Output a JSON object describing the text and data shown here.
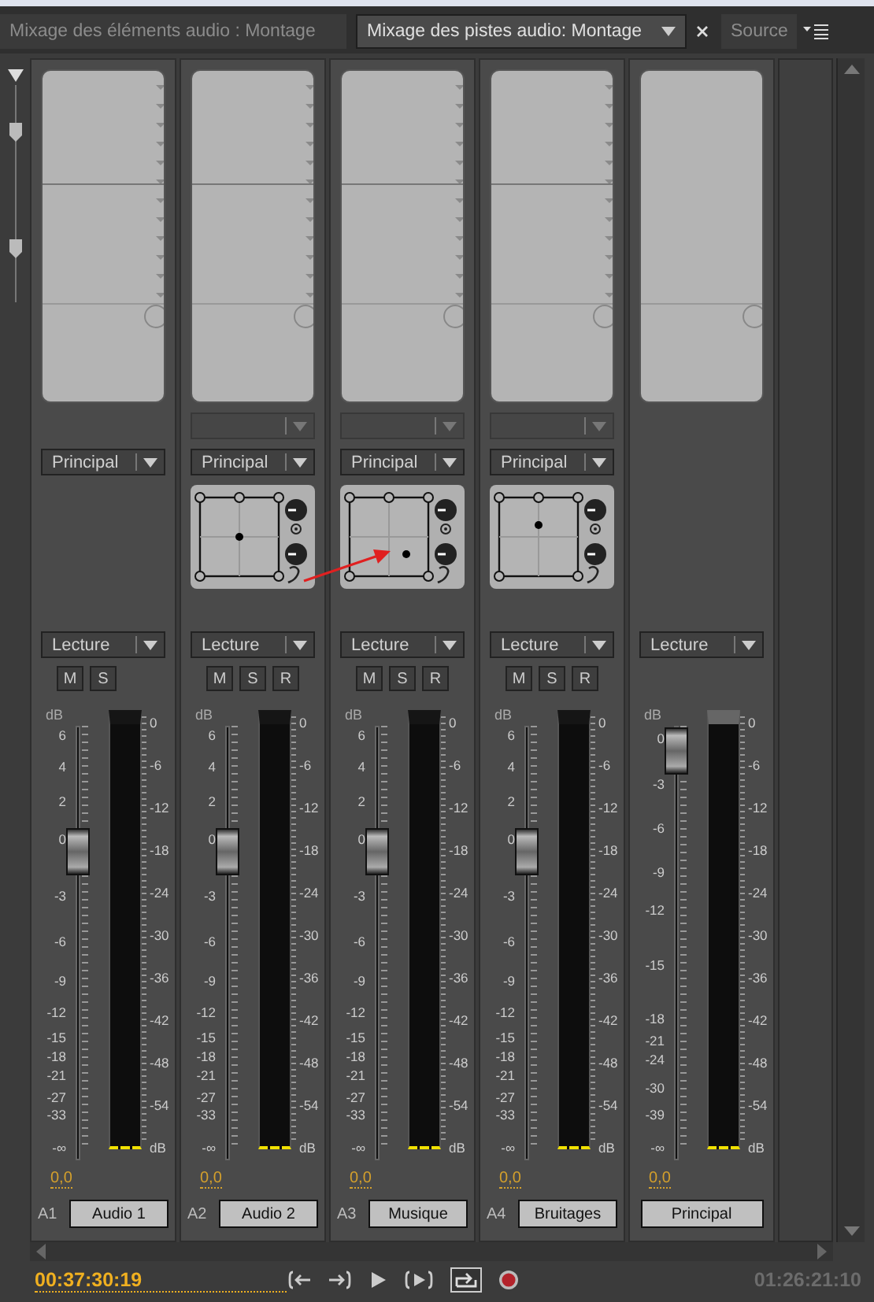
{
  "tabs": [
    {
      "label": "Mixage des éléments audio : Montage",
      "selected": false
    },
    {
      "label": "Mixage des pistes audio: Montage",
      "selected": true
    },
    {
      "label": "Source",
      "selected": false
    }
  ],
  "strips": [
    {
      "kind": "track",
      "send": false,
      "output": "Principal",
      "panner": false,
      "automation": "Lecture",
      "buttons": [
        "M",
        "S"
      ],
      "fader": {
        "labels": [
          "6",
          "4",
          "2",
          "0",
          "-3",
          "-6",
          "-9",
          "-12",
          "-15",
          "-18",
          "-21",
          "-27",
          "-33",
          "-∞"
        ],
        "level": 0.74
      },
      "unit": "dB",
      "meter_labels": [
        "0",
        "-6",
        "-12",
        "-18",
        "-24",
        "-30",
        "-36",
        "-42",
        "-48",
        "-54",
        "dB"
      ],
      "reading": "0,0",
      "id": "A1",
      "name": "Audio 1"
    },
    {
      "kind": "track",
      "send": true,
      "output": "Principal",
      "panner": true,
      "automation": "Lecture",
      "buttons": [
        "M",
        "S",
        "R"
      ],
      "fader": {
        "labels": [
          "6",
          "4",
          "2",
          "0",
          "-3",
          "-6",
          "-9",
          "-12",
          "-15",
          "-18",
          "-21",
          "-27",
          "-33",
          "-∞"
        ],
        "level": 0.74
      },
      "unit": "dB",
      "meter_labels": [
        "0",
        "-6",
        "-12",
        "-18",
        "-24",
        "-30",
        "-36",
        "-42",
        "-48",
        "-54",
        "dB"
      ],
      "reading": "0,0",
      "id": "A2",
      "name": "Audio 2"
    },
    {
      "kind": "track",
      "send": true,
      "output": "Principal",
      "panner": true,
      "automation": "Lecture",
      "buttons": [
        "M",
        "S",
        "R"
      ],
      "fader": {
        "labels": [
          "6",
          "4",
          "2",
          "0",
          "-3",
          "-6",
          "-9",
          "-12",
          "-15",
          "-18",
          "-21",
          "-27",
          "-33",
          "-∞"
        ],
        "level": 0.74
      },
      "unit": "dB",
      "meter_labels": [
        "0",
        "-6",
        "-12",
        "-18",
        "-24",
        "-30",
        "-36",
        "-42",
        "-48",
        "-54",
        "dB"
      ],
      "reading": "0,0",
      "id": "A3",
      "name": "Musique"
    },
    {
      "kind": "track",
      "send": true,
      "output": "Principal",
      "panner": true,
      "automation": "Lecture",
      "buttons": [
        "M",
        "S",
        "R"
      ],
      "fader": {
        "labels": [
          "6",
          "4",
          "2",
          "0",
          "-3",
          "-6",
          "-9",
          "-12",
          "-15",
          "-18",
          "-21",
          "-27",
          "-33",
          "-∞"
        ],
        "level": 0.74
      },
      "unit": "dB",
      "meter_labels": [
        "0",
        "-6",
        "-12",
        "-18",
        "-24",
        "-30",
        "-36",
        "-42",
        "-48",
        "-54",
        "dB"
      ],
      "reading": "0,0",
      "id": "A4",
      "name": "Bruitages"
    },
    {
      "kind": "master",
      "send": false,
      "panner": false,
      "automation": "Lecture",
      "fader": {
        "labels": [
          "0",
          "-3",
          "-6",
          "-9",
          "-12",
          "-15",
          "-18",
          "-21",
          "-24",
          "-30",
          "-39",
          "-∞"
        ],
        "level": 1
      },
      "unit": "dB",
      "meter_labels": [
        "0",
        "-6",
        "-12",
        "-18",
        "-24",
        "-30",
        "-36",
        "-42",
        "-48",
        "-54",
        "dB"
      ],
      "reading": "0,0",
      "name": "Principal"
    }
  ],
  "transport": {
    "current_time": "00:37:30:19",
    "duration": "01:26:21:10"
  }
}
